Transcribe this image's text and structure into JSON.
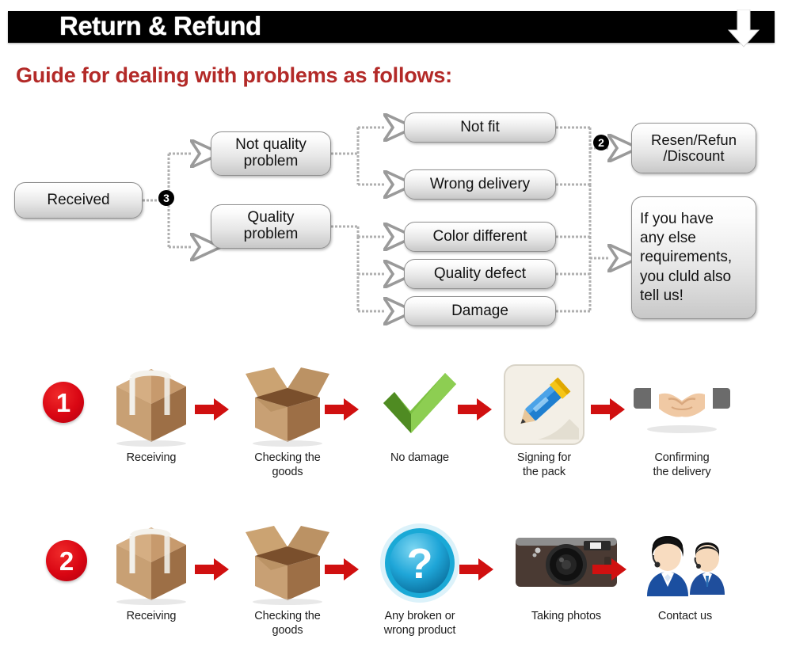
{
  "header": {
    "title": "Return & Refund",
    "down_arrow_icon": "arrow-down-icon",
    "bar_color": "#000000",
    "title_color": "#ffffff"
  },
  "guide": {
    "heading": "Guide for dealing with problems as follows:",
    "heading_color": "#b32a28"
  },
  "flowchart": {
    "markers": [
      {
        "id": "marker-3",
        "label": "3"
      },
      {
        "id": "marker-2",
        "label": "2"
      }
    ],
    "boxes": [
      {
        "id": "received",
        "label": "Received"
      },
      {
        "id": "not-quality",
        "label": "Not quality problem"
      },
      {
        "id": "quality",
        "label": "Quality problem"
      },
      {
        "id": "not-fit",
        "label": "Not fit"
      },
      {
        "id": "wrong-delivery",
        "label": "Wrong delivery"
      },
      {
        "id": "color-different",
        "label": "Color different"
      },
      {
        "id": "quality-defect",
        "label": "Quality defect"
      },
      {
        "id": "damage",
        "label": "Damage"
      },
      {
        "id": "resend",
        "label": "Resen/Refun /Discount"
      },
      {
        "id": "if-you-have",
        "label": "If you have any else requirements, you cluld also tell us!"
      }
    ],
    "box_labels": {
      "received": "Received",
      "not_quality_l1": "Not quality",
      "not_quality_l2": "problem",
      "quality_l1": "Quality",
      "quality_l2": "problem",
      "not_fit": "Not fit",
      "wrong_delivery": "Wrong delivery",
      "color_different": "Color different",
      "quality_defect": "Quality defect",
      "damage": "Damage",
      "resend_l1": "Resen/Refun",
      "resend_l2": "/Discount",
      "ifyou_l1": "If you have",
      "ifyou_l2": "any else",
      "ifyou_l3": "requirements,",
      "ifyou_l4": "you cluld also",
      "ifyou_l5": "tell us!"
    },
    "connector_color": "#a8a8a8"
  },
  "process_rows": [
    {
      "number": "1",
      "number_color": "#d90613",
      "arrow_color": "#d01010",
      "steps": [
        {
          "icon": "sealed-box-icon",
          "label_l1": "Receiving",
          "label_l2": ""
        },
        {
          "icon": "open-box-icon",
          "label_l1": "Checking the",
          "label_l2": "goods"
        },
        {
          "icon": "green-check-icon",
          "label_l1": "No damage",
          "label_l2": ""
        },
        {
          "icon": "pencil-sign-icon",
          "label_l1": "Signing for",
          "label_l2": "the pack"
        },
        {
          "icon": "handshake-icon",
          "label_l1": "Confirming",
          "label_l2": "the delivery"
        }
      ]
    },
    {
      "number": "2",
      "number_color": "#d90613",
      "arrow_color": "#d01010",
      "steps": [
        {
          "icon": "sealed-box-icon",
          "label_l1": "Receiving",
          "label_l2": ""
        },
        {
          "icon": "open-box-icon",
          "label_l1": "Checking the",
          "label_l2": "goods"
        },
        {
          "icon": "blue-question-icon",
          "label_l1": "Any broken or",
          "label_l2": "wrong product"
        },
        {
          "icon": "camera-icon",
          "label_l1": "Taking photos",
          "label_l2": ""
        },
        {
          "icon": "support-agents-icon",
          "label_l1": "Contact us",
          "label_l2": ""
        }
      ]
    }
  ]
}
